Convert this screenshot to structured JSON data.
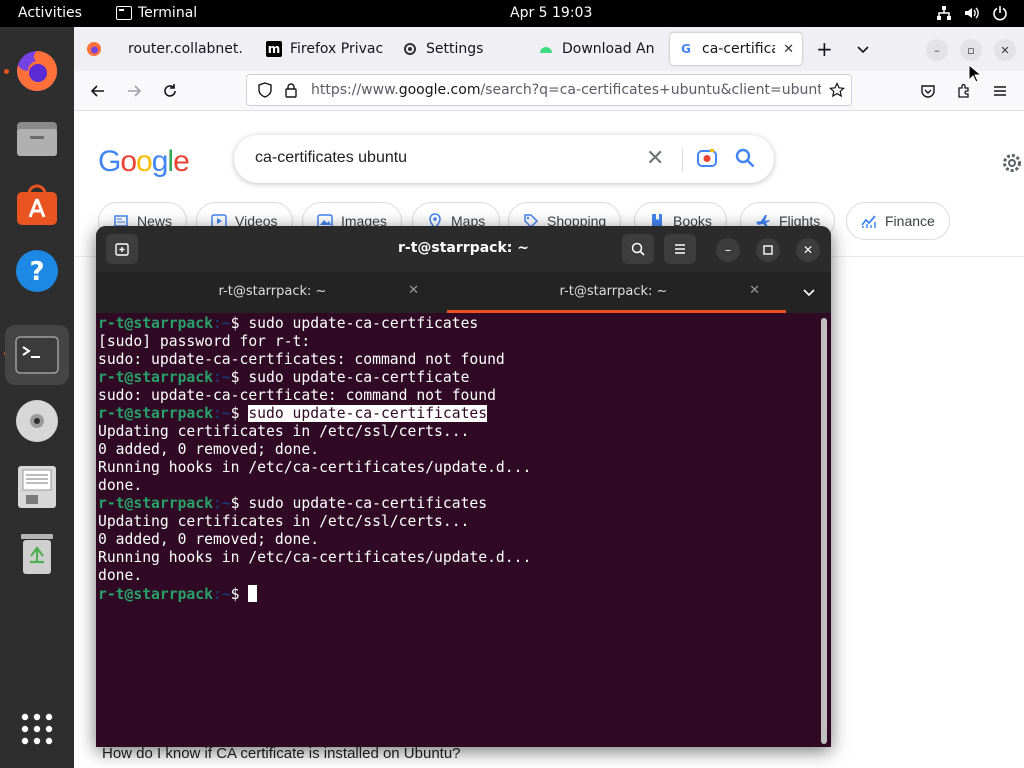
{
  "topbar": {
    "activities": "Activities",
    "app_name": "Terminal",
    "clock": "Apr 5  19:03",
    "tray_icons": [
      "network-icon",
      "volume-icon",
      "power-icon"
    ]
  },
  "dock": {
    "items": [
      {
        "name": "firefox",
        "icon": "firefox-icon",
        "running": true
      },
      {
        "name": "files",
        "icon": "files-icon",
        "running": false
      },
      {
        "name": "app-center",
        "icon": "app-center-icon",
        "running": false
      },
      {
        "name": "help",
        "icon": "help-icon",
        "running": false
      },
      {
        "name": "terminal",
        "icon": "terminal-icon",
        "running": true,
        "active": true
      },
      {
        "name": "disc",
        "icon": "disc-icon",
        "running": false
      },
      {
        "name": "disk-image",
        "icon": "disk-image-icon",
        "running": false
      },
      {
        "name": "trash",
        "icon": "trash-icon",
        "running": false
      }
    ],
    "show_apps": "apps-grid-icon"
  },
  "firefox": {
    "tabs": [
      {
        "label": "router.collabnet.l",
        "icon": "router-icon",
        "selected": false
      },
      {
        "label": "Firefox Privac",
        "icon": "m-icon",
        "selected": false
      },
      {
        "label": "Settings",
        "icon": "gear-icon",
        "selected": false
      },
      {
        "label": "Download An",
        "icon": "android-icon",
        "selected": false
      },
      {
        "label": "ca-certificat",
        "icon": "google-icon",
        "selected": true
      }
    ],
    "new_tab": "+",
    "url_prefix": "https://www.",
    "url_host": "google.com",
    "url_rest": "/search?q=ca-certificates+ubuntu&client=ubuntu",
    "google": {
      "query": "ca-certificates ubuntu",
      "chips": [
        "News",
        "Videos",
        "Images",
        "Maps",
        "Shopping",
        "Books",
        "Flights",
        "Finance"
      ],
      "result_partial": "How do I know if CA certificate is installed on Ubuntu?"
    }
  },
  "terminal": {
    "title": "r-t@starrpack: ~",
    "tabs": [
      {
        "label": "r-t@starrpack: ~",
        "active": false
      },
      {
        "label": "r-t@starrpack: ~",
        "active": true
      }
    ],
    "prompt_user": "r-t@starrpack",
    "prompt_path": ":~",
    "prompt_sign": "$ ",
    "lines": [
      {
        "type": "cmd",
        "text": "sudo update-ca-certficates"
      },
      {
        "type": "out",
        "text": "[sudo] password for r-t:"
      },
      {
        "type": "out",
        "text": "sudo: update-ca-certficates: command not found"
      },
      {
        "type": "cmd",
        "text": "sudo update-ca-certficate"
      },
      {
        "type": "out",
        "text": "sudo: update-ca-certficate: command not found"
      },
      {
        "type": "cmd",
        "text": "sudo update-ca-certificates",
        "selected": true
      },
      {
        "type": "out",
        "text": "Updating certificates in /etc/ssl/certs..."
      },
      {
        "type": "out",
        "text": "0 added, 0 removed; done."
      },
      {
        "type": "out",
        "text": "Running hooks in /etc/ca-certificates/update.d..."
      },
      {
        "type": "out",
        "text": "done."
      },
      {
        "type": "cmd",
        "text": "sudo update-ca-certificates"
      },
      {
        "type": "out",
        "text": "Updating certificates in /etc/ssl/certs..."
      },
      {
        "type": "out",
        "text": "0 added, 0 removed; done."
      },
      {
        "type": "out",
        "text": "Running hooks in /etc/ca-certificates/update.d..."
      },
      {
        "type": "out",
        "text": "done."
      },
      {
        "type": "cursor",
        "text": ""
      }
    ]
  },
  "colors": {
    "terminal_bg": "#300a24",
    "prompt_green": "#26a269",
    "ubuntu_orange": "#e95420",
    "dock_bg": "#2e2e2e"
  }
}
